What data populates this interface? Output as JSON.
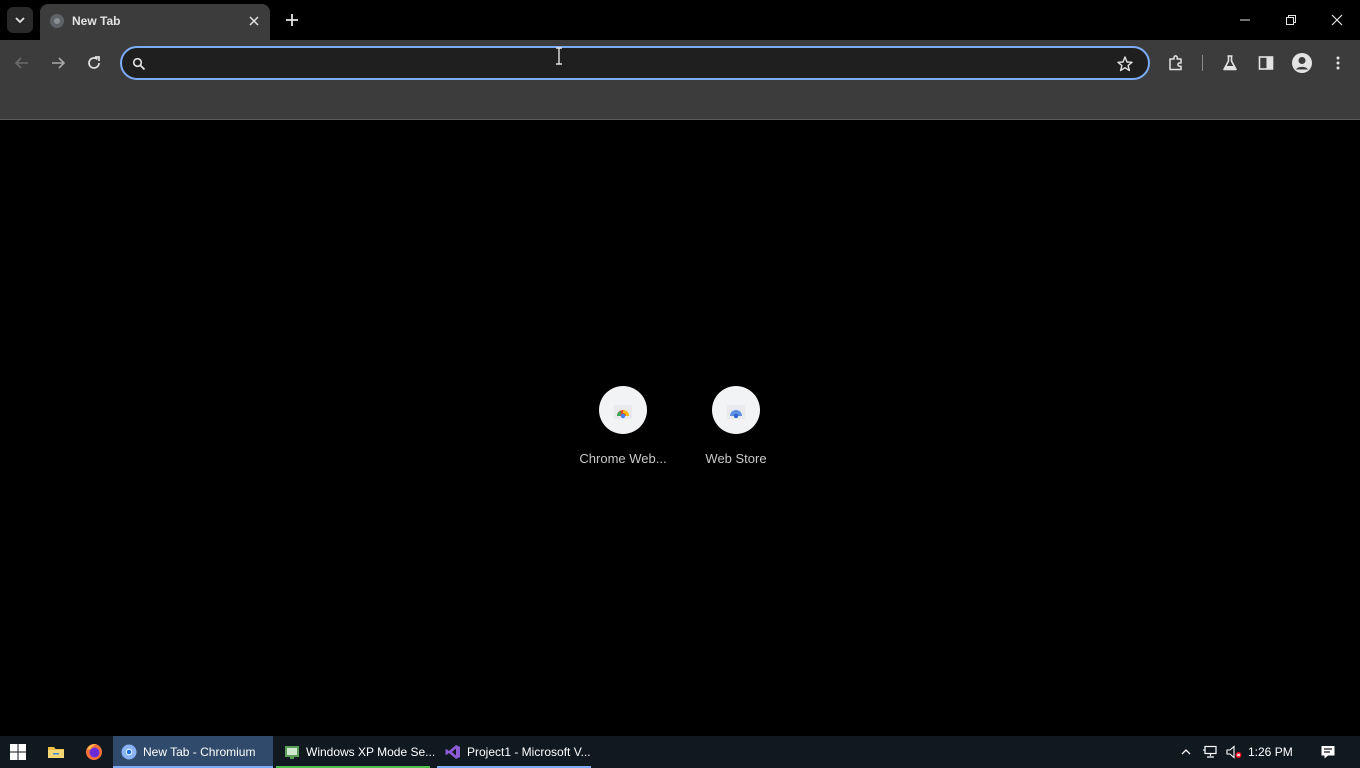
{
  "browser": {
    "tab": {
      "title": "New Tab"
    },
    "omnibox": {
      "value": "",
      "placeholder": ""
    }
  },
  "shortcuts": [
    {
      "label": "Chrome Web...",
      "icon": "chrome-web-store-icon"
    },
    {
      "label": "Web Store",
      "icon": "web-store-icon"
    }
  ],
  "taskbar": {
    "apps": [
      {
        "label": "New Tab - Chromium",
        "icon": "chromium-icon",
        "active": true
      },
      {
        "label": "Windows XP Mode Se...",
        "icon": "windows-xp-mode-icon",
        "active": false
      },
      {
        "label": "Project1 - Microsoft V...",
        "icon": "visual-studio-icon",
        "active": false
      }
    ],
    "time": "1:26 PM"
  },
  "colors": {
    "accent": "#7cacf8",
    "toolbar": "#3c3c3c",
    "taskbar": "#101820",
    "taskbar_active": "#2f4a6a",
    "xp_mode_underline": "#4cc24c",
    "vs_purple": "#8c5cd6"
  }
}
